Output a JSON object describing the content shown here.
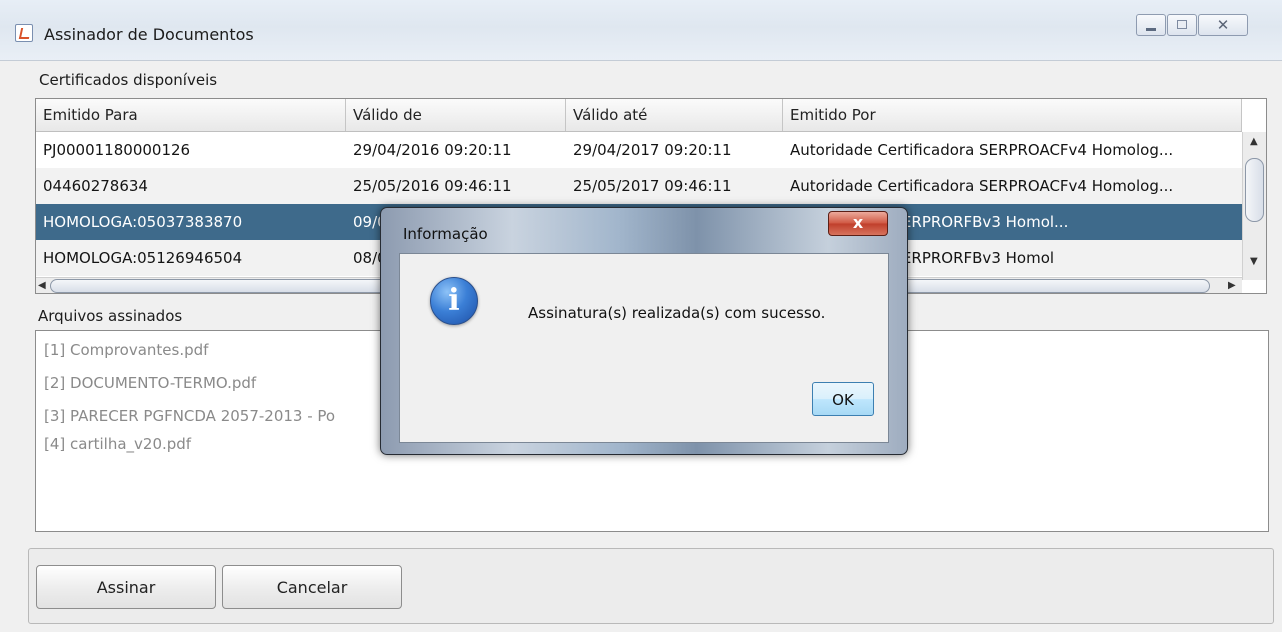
{
  "window": {
    "title": "Assinador de Documentos",
    "controls": {
      "close_glyph": "✕"
    }
  },
  "certificates": {
    "section_label": "Certificados disponíveis",
    "columns": [
      "Emitido Para",
      "Válido de",
      "Válido até",
      "Emitido Por"
    ],
    "rows": [
      [
        "PJ00001180000126",
        "29/04/2016 09:20:11",
        "29/04/2017 09:20:11",
        "Autoridade Certificadora SERPROACFv4 Homolog..."
      ],
      [
        "04460278634",
        "25/05/2016 09:46:11",
        "25/05/2017 09:46:11",
        "Autoridade Certificadora SERPROACFv4 Homolog..."
      ],
      [
        "HOMOLOGA:05037383870",
        "09/0",
        "",
        "rtificadora ACSERPRORFBv3 Homol..."
      ],
      [
        "HOMOLOGA:05126946504",
        "08/0",
        "",
        "rtificadora ACSERPRORFBv3 Homol"
      ]
    ],
    "selected_row": 2
  },
  "signed_files": {
    "section_label": "Arquivos assinados",
    "items": [
      "[1] Comprovantes.pdf",
      "[2] DOCUMENTO-TERMO.pdf",
      "[3] PARECER PGFNCDA 2057-2013 - Po",
      "[4] cartilha_v20.pdf"
    ]
  },
  "buttons": {
    "sign": "Assinar",
    "cancel": "Cancelar"
  },
  "dialog": {
    "title": "Informação",
    "icon": "info-icon",
    "icon_glyph": "i",
    "message": "Assinatura(s) realizada(s) com sucesso.",
    "ok": "OK",
    "close_glyph": "x"
  }
}
